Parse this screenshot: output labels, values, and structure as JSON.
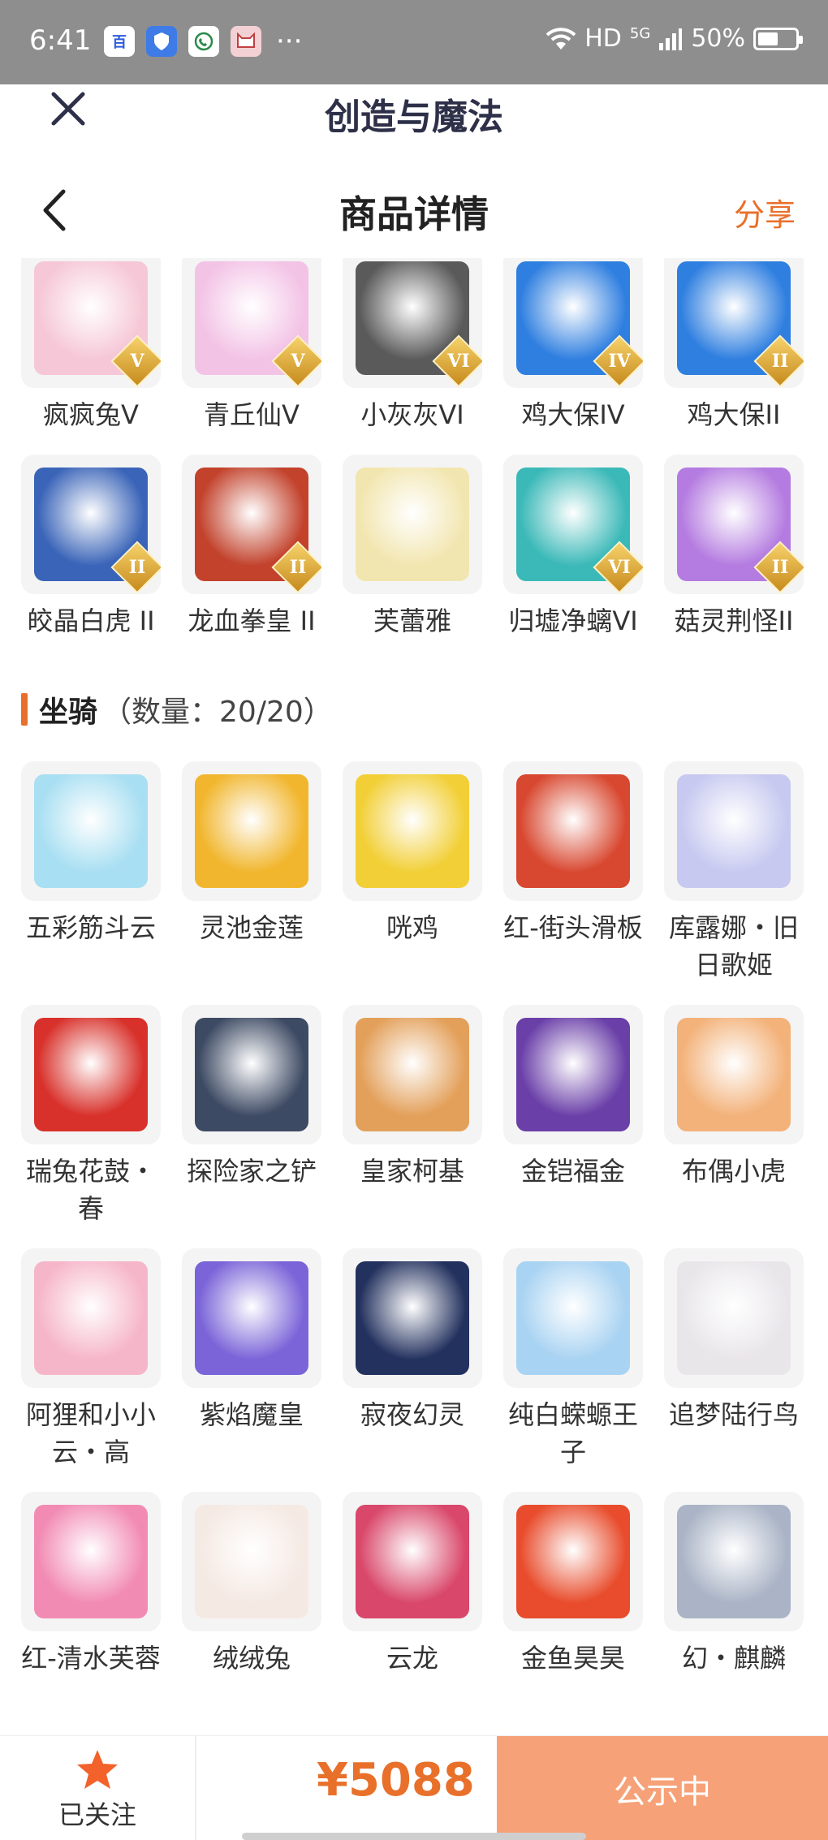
{
  "status_bar": {
    "time": "6:41",
    "dots": "···",
    "network": "HD",
    "signal": "5G",
    "battery": "50%",
    "app_icons": [
      "baidu-icon",
      "shield-icon",
      "phone-icon",
      "cat-icon"
    ]
  },
  "header": {
    "app_title": "创造与魔法",
    "nav_title": "商品详情",
    "share_label": "分享"
  },
  "top_items": [
    {
      "name": "疯疯兔V",
      "rank": "V",
      "color": "#f6c7d6"
    },
    {
      "name": "青丘仙V",
      "rank": "V",
      "color": "#f3c3e6"
    },
    {
      "name": "小灰灰VI",
      "rank": "VI",
      "color": "#5a5a5a"
    },
    {
      "name": "鸡大保IV",
      "rank": "IV",
      "color": "#2f7fe0"
    },
    {
      "name": "鸡大保II",
      "rank": "II",
      "color": "#2f7fe0"
    },
    {
      "name": "皎晶白虎 II",
      "rank": "II",
      "color": "#3a64b8"
    },
    {
      "name": "龙血拳皇 II",
      "rank": "II",
      "color": "#c2422c"
    },
    {
      "name": "芙蕾雅",
      "rank": "",
      "color": "#f2e6b0"
    },
    {
      "name": "归墟净螭VI",
      "rank": "VI",
      "color": "#3bb9b8"
    },
    {
      "name": "菇灵荆怪II",
      "rank": "II",
      "color": "#b47be0"
    }
  ],
  "mounts_section": {
    "title": "坐骑",
    "count": "（数量：20/20）"
  },
  "mounts": [
    {
      "name": "五彩筋斗云",
      "color": "#a8dff2"
    },
    {
      "name": "灵池金莲",
      "color": "#f1b62d"
    },
    {
      "name": "咣鸡",
      "color": "#f2cf36"
    },
    {
      "name": "红-街头滑板",
      "color": "#d8472f"
    },
    {
      "name": "库露娜・旧日歌姬",
      "color": "#c7c9f0"
    },
    {
      "name": "瑞兔花鼓・春",
      "color": "#d8302a"
    },
    {
      "name": "探险家之铲",
      "color": "#3d4a63"
    },
    {
      "name": "皇家柯基",
      "color": "#e3a05a"
    },
    {
      "name": "金铠福金",
      "color": "#6a3fa8"
    },
    {
      "name": "布偶小虎",
      "color": "#f3b27a"
    },
    {
      "name": "阿狸和小小云・高",
      "color": "#f6b6c9"
    },
    {
      "name": "紫焰魔皇",
      "color": "#7a64d8"
    },
    {
      "name": "寂夜幻灵",
      "color": "#23315e"
    },
    {
      "name": "纯白蝾螈王子",
      "color": "#a9d3f2"
    },
    {
      "name": "追梦陆行鸟",
      "color": "#e9e6ea"
    },
    {
      "name": "红-清水芙蓉",
      "color": "#f28bb4"
    },
    {
      "name": "绒绒兔",
      "color": "#f5e9e3"
    },
    {
      "name": "云龙",
      "color": "#d9476a"
    },
    {
      "name": "金鱼昊昊",
      "color": "#e84c2c"
    },
    {
      "name": "幻・麒麟",
      "color": "#aab4c6"
    }
  ],
  "bottom": {
    "follow_label": "已关注",
    "price": "¥5088",
    "status_label": "公示中"
  },
  "colors": {
    "accent": "#e8702a",
    "status_button": "#f6a178"
  }
}
